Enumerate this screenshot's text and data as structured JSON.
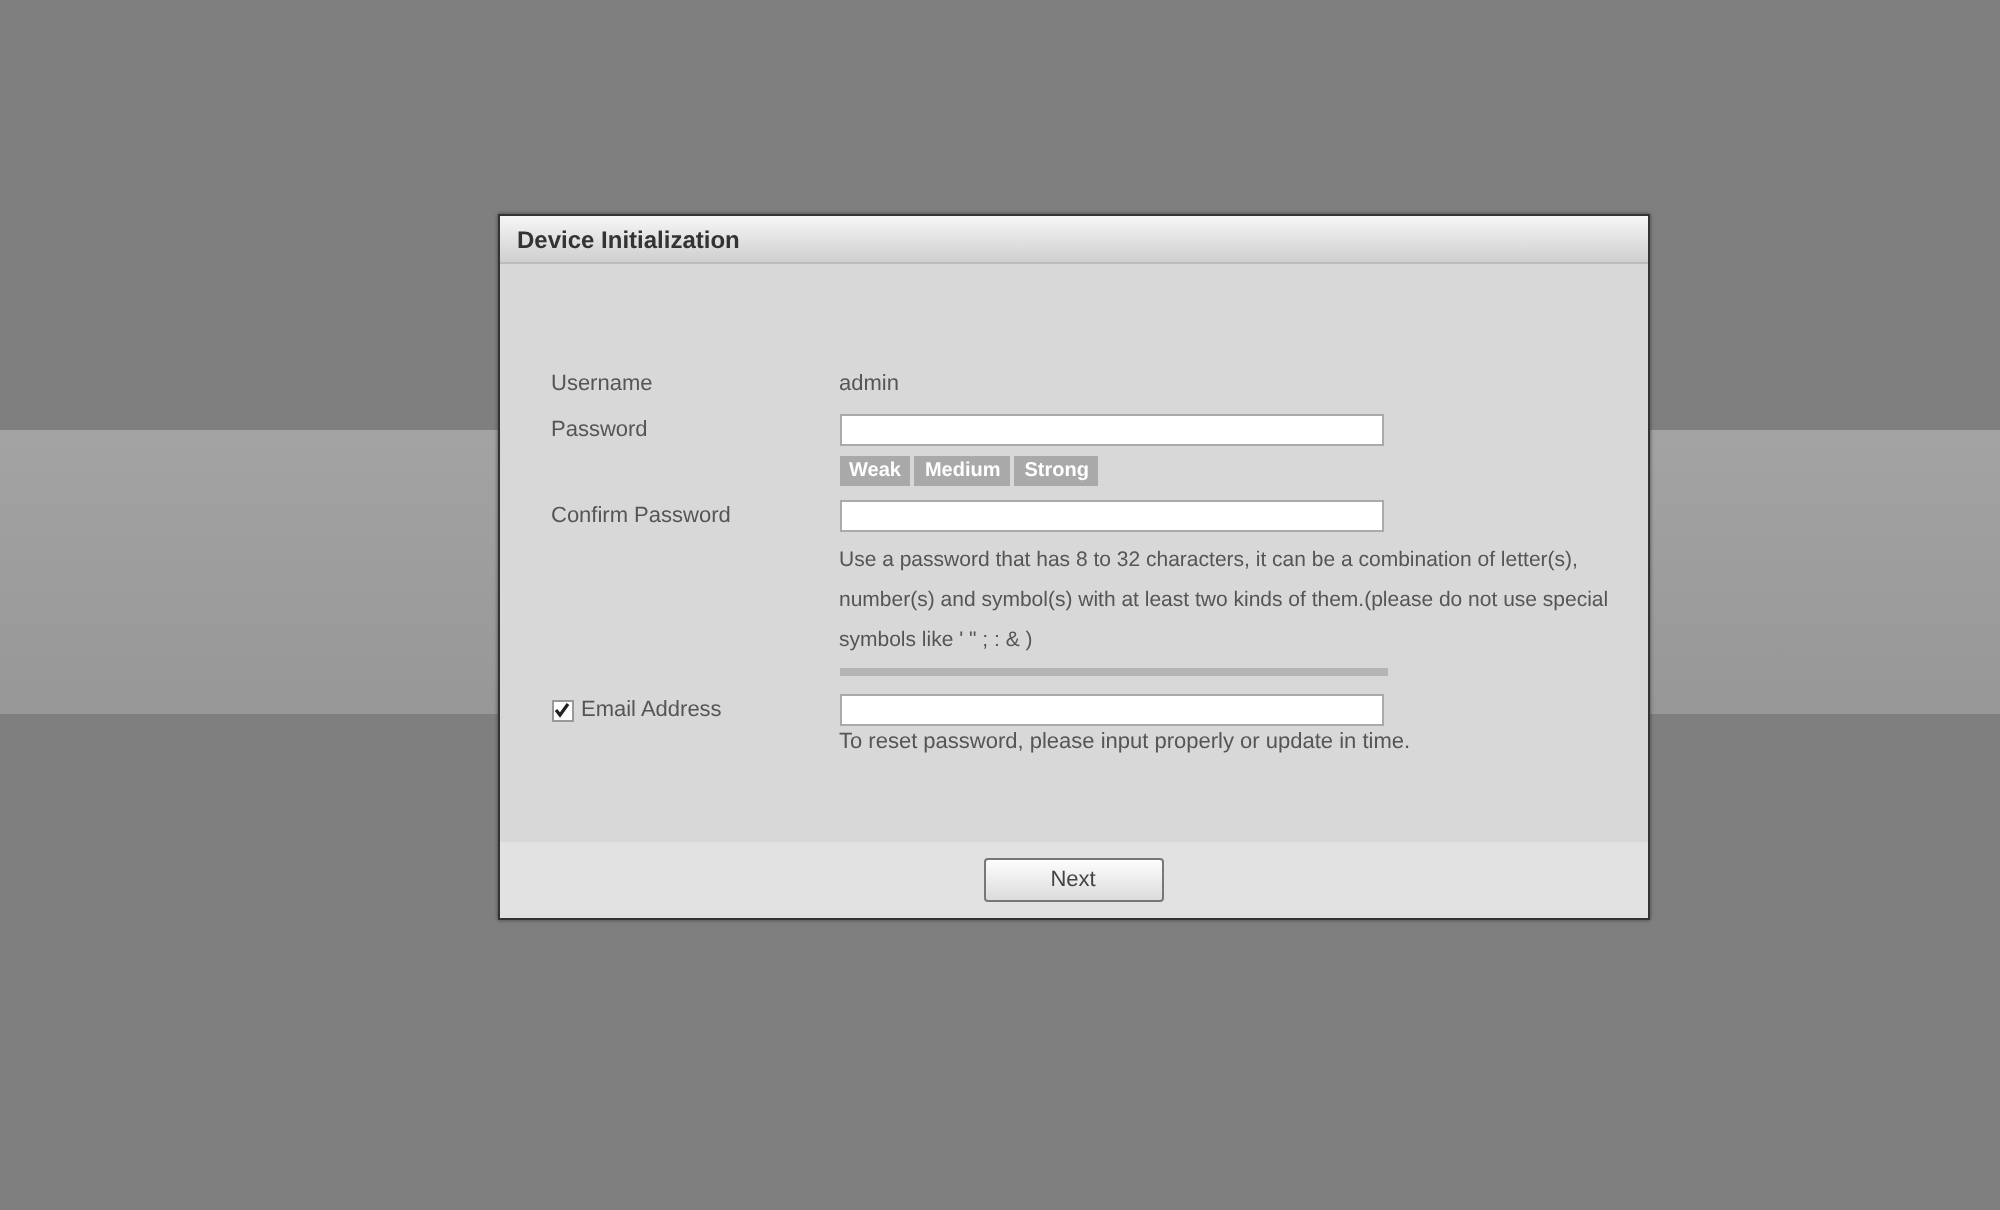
{
  "dialog": {
    "title": "Device Initialization",
    "username": {
      "label": "Username",
      "value": "admin"
    },
    "password": {
      "label": "Password"
    },
    "strength_levels": [
      "Weak",
      "Medium",
      "Strong"
    ],
    "confirm_password": {
      "label": "Confirm Password"
    },
    "hint": "Use a password that has 8 to 32 characters, it can be a combination of letter(s), number(s) and symbol(s) with at least two kinds of them.(please do not use special symbols like ' \" ; : & )",
    "email": {
      "label": "Email Address",
      "checked": true,
      "note": "To reset password, please input properly or update in time."
    },
    "next_button": "Next"
  }
}
